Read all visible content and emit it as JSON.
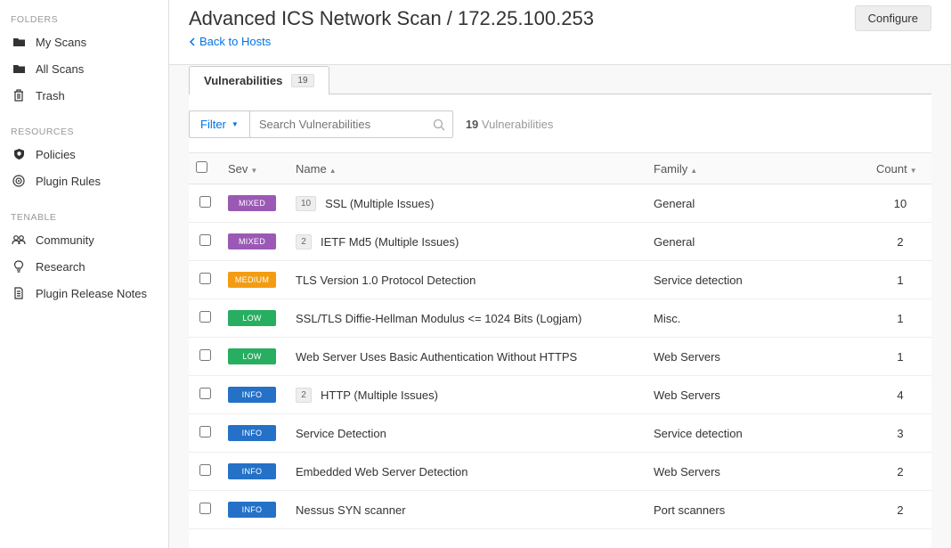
{
  "sidebar": {
    "sections": [
      {
        "title": "FOLDERS",
        "items": [
          {
            "label": "My Scans",
            "icon": "folder"
          },
          {
            "label": "All Scans",
            "icon": "folder"
          },
          {
            "label": "Trash",
            "icon": "trash"
          }
        ]
      },
      {
        "title": "RESOURCES",
        "items": [
          {
            "label": "Policies",
            "icon": "shield"
          },
          {
            "label": "Plugin Rules",
            "icon": "target"
          }
        ]
      },
      {
        "title": "TENABLE",
        "items": [
          {
            "label": "Community",
            "icon": "users"
          },
          {
            "label": "Research",
            "icon": "bulb"
          },
          {
            "label": "Plugin Release Notes",
            "icon": "doc"
          }
        ]
      }
    ]
  },
  "header": {
    "title": "Advanced ICS Network Scan / 172.25.100.253",
    "back_label": "Back to Hosts",
    "configure_label": "Configure"
  },
  "tab": {
    "label": "Vulnerabilities",
    "count": "19"
  },
  "filter": {
    "button_label": "Filter",
    "search_placeholder": "Search Vulnerabilities",
    "result_count": "19",
    "result_label": "Vulnerabilities"
  },
  "columns": {
    "sev": "Sev",
    "name": "Name",
    "family": "Family",
    "count": "Count"
  },
  "rows": [
    {
      "sev": "MIXED",
      "sub": "10",
      "name": "SSL (Multiple Issues)",
      "family": "General",
      "count": "10"
    },
    {
      "sev": "MIXED",
      "sub": "2",
      "name": "IETF Md5 (Multiple Issues)",
      "family": "General",
      "count": "2"
    },
    {
      "sev": "MEDIUM",
      "sub": "",
      "name": "TLS Version 1.0 Protocol Detection",
      "family": "Service detection",
      "count": "1"
    },
    {
      "sev": "LOW",
      "sub": "",
      "name": "SSL/TLS Diffie-Hellman Modulus <= 1024 Bits (Logjam)",
      "family": "Misc.",
      "count": "1"
    },
    {
      "sev": "LOW",
      "sub": "",
      "name": "Web Server Uses Basic Authentication Without HTTPS",
      "family": "Web Servers",
      "count": "1"
    },
    {
      "sev": "INFO",
      "sub": "2",
      "name": "HTTP (Multiple Issues)",
      "family": "Web Servers",
      "count": "4"
    },
    {
      "sev": "INFO",
      "sub": "",
      "name": "Service Detection",
      "family": "Service detection",
      "count": "3"
    },
    {
      "sev": "INFO",
      "sub": "",
      "name": "Embedded Web Server Detection",
      "family": "Web Servers",
      "count": "2"
    },
    {
      "sev": "INFO",
      "sub": "",
      "name": "Nessus SYN scanner",
      "family": "Port scanners",
      "count": "2"
    }
  ]
}
